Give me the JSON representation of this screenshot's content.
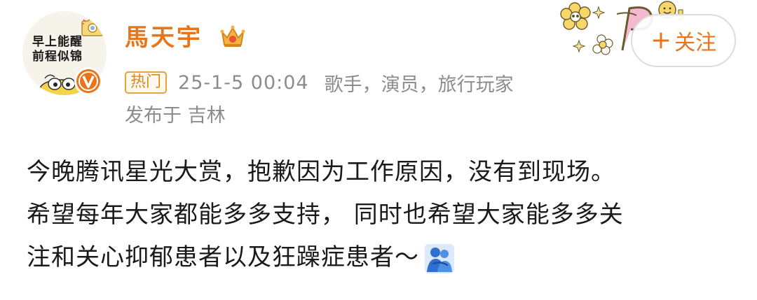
{
  "avatar": {
    "caption_line1": "早上能醒",
    "caption_line2": "前程似锦"
  },
  "user": {
    "name": "馬天宇"
  },
  "meta": {
    "badge": "热门",
    "time": "25-1-5 00:04",
    "tags": "歌手，演员，旅行玩家",
    "location": "发布于 吉林"
  },
  "follow": {
    "plus": "+",
    "label": "关注"
  },
  "post": {
    "lines": [
      "今晚腾讯星光大赏，抱歉因为工作原因，没有到现场。",
      "希望每年大家都能多多支持， 同时也希望大家能多多关",
      "注和关心抑郁患者以及狂躁症患者～"
    ],
    "emoji": "hug-icon"
  },
  "colors": {
    "accent": "#e8751a",
    "meta": "#8c8c8c",
    "badge_border": "#e6a33c",
    "verified": "#e8751a"
  }
}
